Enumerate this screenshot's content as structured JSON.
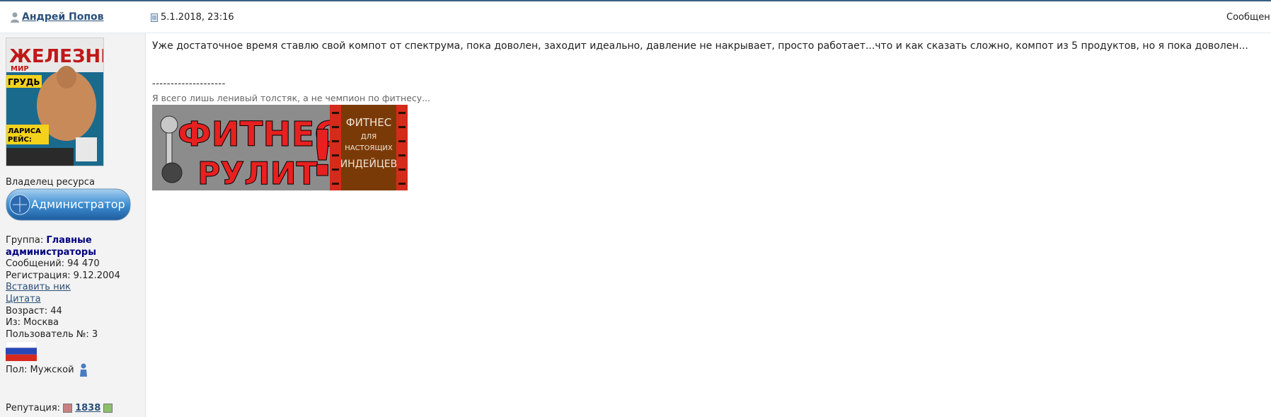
{
  "header": {
    "author": "Андрей Попов",
    "date": "5.1.2018, 23:16",
    "right_label": "Сообщени"
  },
  "user": {
    "avatar": {
      "description_texts": [
        "ЖЕЛЕЗНЫЙ",
        "МИР",
        "ГРУДЬ",
        "ЛАРИСА",
        "РЕЙС:"
      ]
    },
    "role_title": "Владелец ресурса",
    "badge_label": "Администратор",
    "group_label": "Группа:",
    "group_value": "Главные администраторы",
    "messages": "Сообщений: 94 470",
    "registration": "Регистрация: 9.12.2004",
    "insert_nick": "Вставить ник",
    "quote": "Цитата",
    "age": "Возраст: 44",
    "from": "Из: Москва",
    "user_number": "Пользователь №: 3",
    "gender": "Пол: Мужской",
    "reputation_label": "Репутация:",
    "reputation_value": "1838"
  },
  "post": {
    "text": "Уже достаточное время ставлю свой компот от спектрума, пока доволен, заходит идеально, давление не накрывает, просто работает...что и как сказать сложно, компот из 5 продуктов, но я пока доволен...",
    "separator": "--------------------",
    "signature": "Я всего лишь ленивый толстяк, а не чемпион по фитнесу...",
    "banner": {
      "left_line1": "ФИТНЕС",
      "left_line2": "РУЛИТ",
      "exclamation": "!",
      "right_line1": "ФИТНЕС",
      "right_line2": "ДЛЯ",
      "right_line3": "НАСТОЯЩИХ",
      "right_line4": "ИНДЕЙЦЕВ"
    }
  },
  "colors": {
    "link": "#2a4f7a",
    "group": "#000080",
    "banner_red": "#e82020",
    "banner_brown": "#7a3a08"
  }
}
